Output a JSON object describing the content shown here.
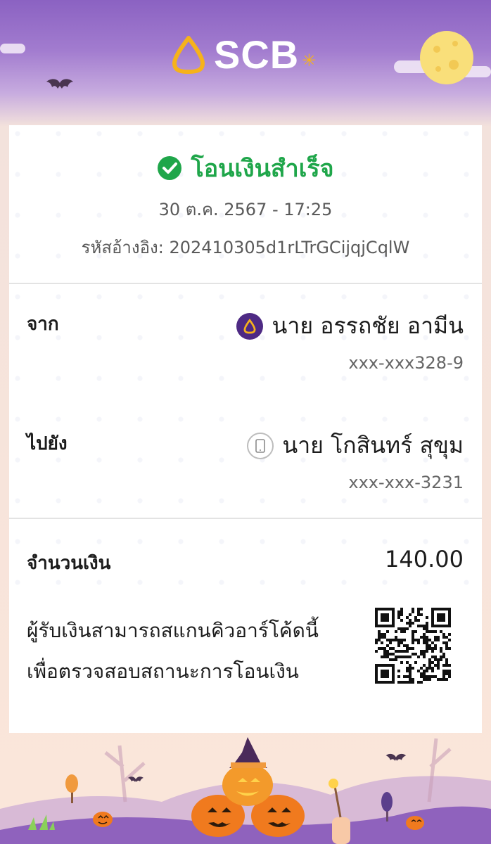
{
  "header": {
    "brand": "SCB"
  },
  "receipt": {
    "status": "โอนเงินสำเร็จ",
    "datetime": "30 ต.ค. 2567 - 17:25",
    "reference": "รหัสอ้างอิง: 202410305d1rLTrGCijqjCqlW"
  },
  "from": {
    "label": "จาก",
    "name": "นาย อรรถชัย อามีน",
    "account": "xxx-xxx328-9",
    "icon": "scb-bank-icon"
  },
  "to": {
    "label": "ไปยัง",
    "name": "นาย โกสินทร์ สุขุม",
    "account": "xxx-xxx-3231",
    "icon": "mobile-phone-icon"
  },
  "amount": {
    "label": "จำนวนเงิน",
    "value": "140.00"
  },
  "verify": {
    "line1": "ผู้รับเงินสามารถสแกนคิวอาร์โค้ดนี้",
    "line2": "เพื่อตรวจสอบสถานะการโอนเงิน"
  },
  "colors": {
    "brand_purple": "#4e2a84",
    "success_green": "#1fa64a",
    "header_purple": "#8b62c2",
    "logo_gold": "#f6b21b"
  }
}
